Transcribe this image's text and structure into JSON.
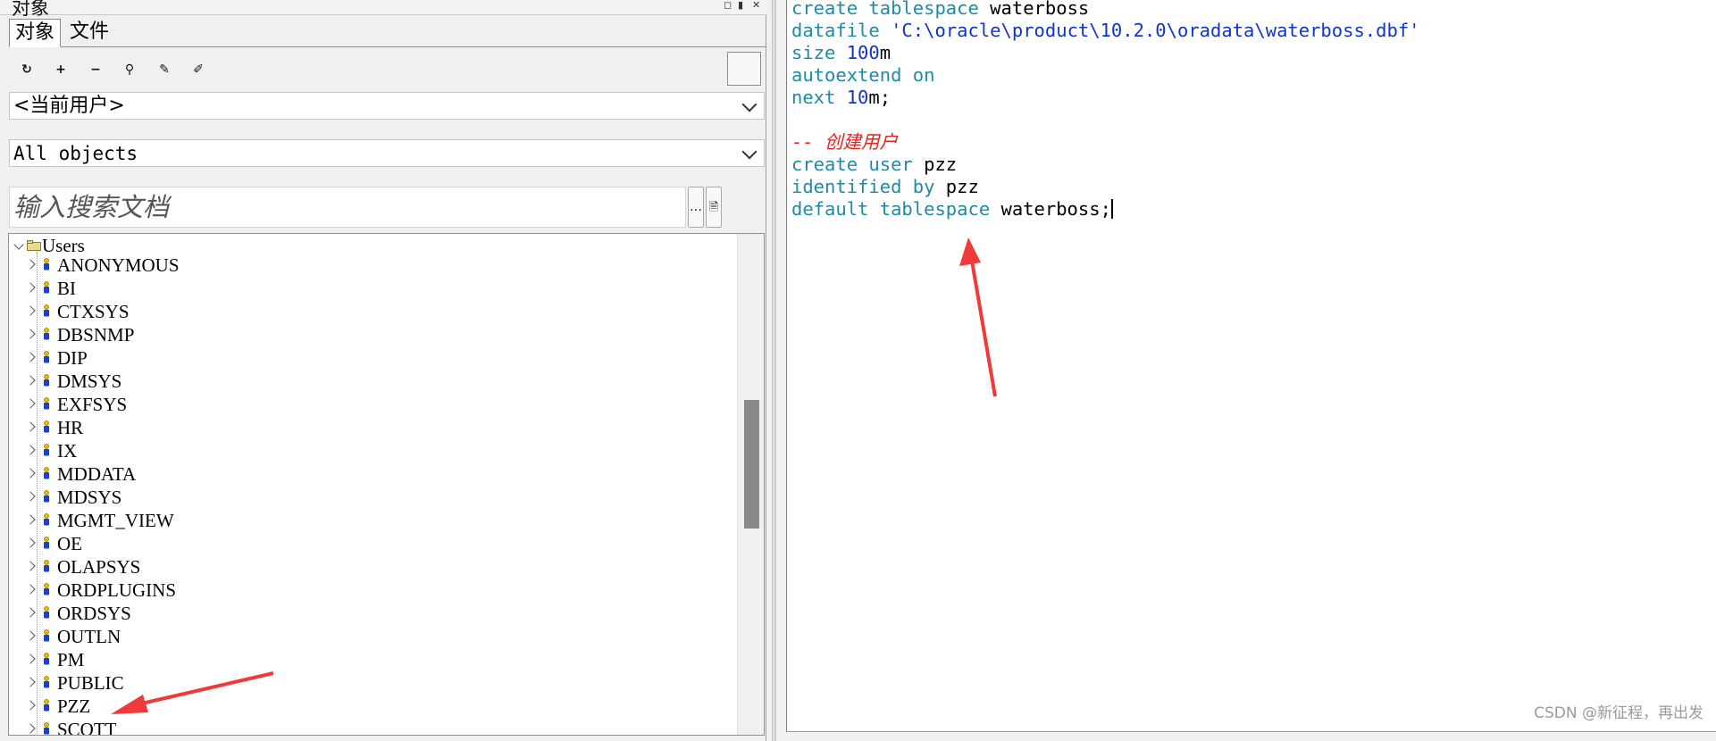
{
  "panel": {
    "title": "对象",
    "controls": [
      "◻",
      "▮",
      "✕"
    ]
  },
  "tabs": [
    {
      "label": "对象",
      "active": true
    },
    {
      "label": "文件",
      "active": false
    }
  ],
  "toolbar": {
    "buttons": [
      {
        "icon": "refresh-icon",
        "glyph": "↻"
      },
      {
        "icon": "add-icon",
        "glyph": "+"
      },
      {
        "icon": "remove-icon",
        "glyph": "−"
      },
      {
        "icon": "find-icon",
        "glyph": "⚲"
      },
      {
        "icon": "edit-icon",
        "glyph": "✎"
      },
      {
        "icon": "properties-icon",
        "glyph": "✐"
      }
    ]
  },
  "filters": {
    "user_filter": "<当前用户>",
    "object_filter": "All objects"
  },
  "search": {
    "placeholder": "输入搜索文档",
    "more_button": "…",
    "doc_button": "🗎"
  },
  "tree": {
    "root": {
      "label": "Users",
      "icon": "folder-icon",
      "expanded": true
    },
    "items": [
      "ANONYMOUS",
      "BI",
      "CTXSYS",
      "DBSNMP",
      "DIP",
      "DMSYS",
      "EXFSYS",
      "HR",
      "IX",
      "MDDATA",
      "MDSYS",
      "MGMT_VIEW",
      "OE",
      "OLAPSYS",
      "ORDPLUGINS",
      "ORDSYS",
      "OUTLN",
      "PM",
      "PUBLIC",
      "PZZ",
      "SCOTT"
    ],
    "highlighted": "PZZ"
  },
  "editor": {
    "lines": [
      [
        {
          "t": "create tablespace ",
          "c": "kw"
        },
        {
          "t": "waterboss",
          "c": ""
        }
      ],
      [
        {
          "t": "datafile ",
          "c": "kw"
        },
        {
          "t": "'C:\\oracle\\product\\10.2.0\\oradata\\waterboss.dbf'",
          "c": "str"
        }
      ],
      [
        {
          "t": "size ",
          "c": "kw"
        },
        {
          "t": "100",
          "c": "num"
        },
        {
          "t": "m",
          "c": ""
        }
      ],
      [
        {
          "t": "autoextend on",
          "c": "kw"
        }
      ],
      [
        {
          "t": "next ",
          "c": "kw"
        },
        {
          "t": "10",
          "c": "num"
        },
        {
          "t": "m;",
          "c": ""
        }
      ],
      [],
      [
        {
          "t": "-- 创建用户",
          "c": "cmt"
        }
      ],
      [
        {
          "t": "create user ",
          "c": "kw"
        },
        {
          "t": "pzz",
          "c": ""
        }
      ],
      [
        {
          "t": "identified by ",
          "c": "kw"
        },
        {
          "t": "pzz",
          "c": ""
        }
      ],
      [
        {
          "t": "default tablespace ",
          "c": "kw"
        },
        {
          "t": "waterboss;",
          "c": ""
        }
      ]
    ],
    "caret_line": 9
  },
  "watermark": "CSDN @新征程，再出发",
  "colors": {
    "keyword": "#1d8ba5",
    "string": "#1034c9",
    "comment": "#e8231c",
    "arrow": "#f03a3a"
  }
}
